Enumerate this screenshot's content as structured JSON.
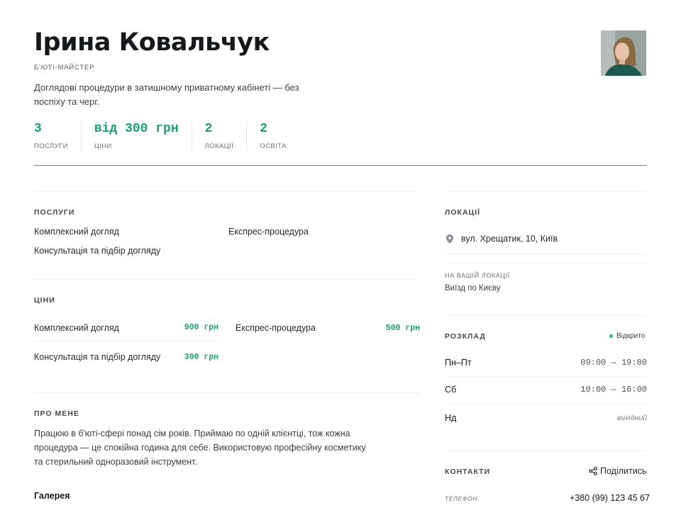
{
  "profile": {
    "name": "Ірина Ковальчук",
    "role": "Б'ЮТІ-МАЙСТЕР",
    "tagline": "Доглядові процедури в затишному приватному кабінеті — без поспіху та черг."
  },
  "stats": [
    {
      "value": "3",
      "label": "ПОСЛУГИ"
    },
    {
      "value": "від 300 грн",
      "label": "ЦІНИ"
    },
    {
      "value": "2",
      "label": "ЛОКАЦІЇ"
    },
    {
      "value": "2",
      "label": "ОСВІТА"
    }
  ],
  "services": {
    "title": "ПОСЛУГИ",
    "items": [
      "Комплексний догляд",
      "Експрес-процедура",
      "Консультація та підбір догляду"
    ]
  },
  "prices": {
    "title": "ЦІНИ",
    "items": [
      {
        "name": "Комплексний догляд",
        "price": "900 грн"
      },
      {
        "name": "Експрес-процедура",
        "price": "500 грн"
      },
      {
        "name": "Консультація та підбір догляду",
        "price": "300 грн"
      }
    ]
  },
  "about": {
    "title": "ПРО МЕНЕ",
    "text": "Працюю в б'юті-сфері понад сім років. Приймаю по одній клієнтці, тож кожна процедура — це спокійна година для себе. Використовую професійну косметику та стерильний одноразовий інструмент."
  },
  "gallery": {
    "title": "Галерея"
  },
  "locations": {
    "title": "ЛОКАЦІЇ",
    "address": "вул. Хрещатик, 10, Київ",
    "at_your_label": "НА ВАШІЙ ЛОКАЦІЇ",
    "at_your_value": "Виїзд по Києву"
  },
  "schedule": {
    "title": "РОЗКЛАД",
    "status": "Відкрито",
    "rows": [
      {
        "day": "Пн–Пт",
        "hours": "09:00 — 19:00"
      },
      {
        "day": "Сб",
        "hours": "10:00 — 16:00"
      },
      {
        "day": "Нд",
        "hours": "вихідний"
      }
    ]
  },
  "contacts": {
    "title": "КОНТАКТИ",
    "share_label": "Поділитись",
    "phone_label": "ТЕЛЕФОН",
    "phone": "+380 (99) 123 45 67"
  },
  "colors": {
    "accent": "#1f9d6b",
    "divider_accent": "#3aa57a",
    "status_dot": "#22b573"
  },
  "icons": [
    "location-pin-icon",
    "share-icon",
    "status-dot"
  ]
}
